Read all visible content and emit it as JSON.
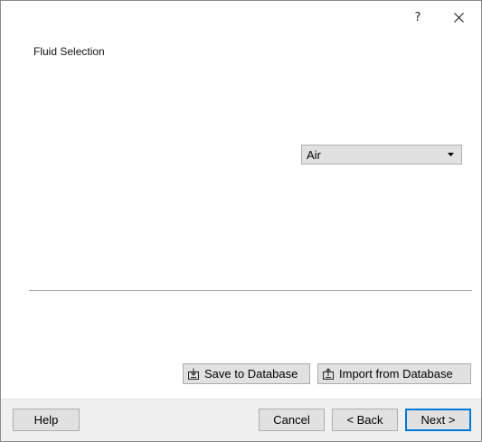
{
  "titlebar": {
    "help_glyph": "?",
    "close_icon": "close-icon"
  },
  "page": {
    "title": "Fluid Selection"
  },
  "fluid_combo": {
    "selected": "Air",
    "arrow_icon": "dropdown-arrow-icon"
  },
  "database_buttons": {
    "save_label": "Save to Database",
    "save_icon": "save-to-database-icon",
    "import_label": "Import from Database",
    "import_icon": "import-from-database-icon"
  },
  "footer": {
    "help_label": "Help",
    "cancel_label": "Cancel",
    "back_label": "< Back",
    "next_label": "Next >"
  },
  "colors": {
    "default_button_border": "#0078d7",
    "button_face": "#e1e1e1",
    "footer_bg": "#f0f0f0"
  }
}
